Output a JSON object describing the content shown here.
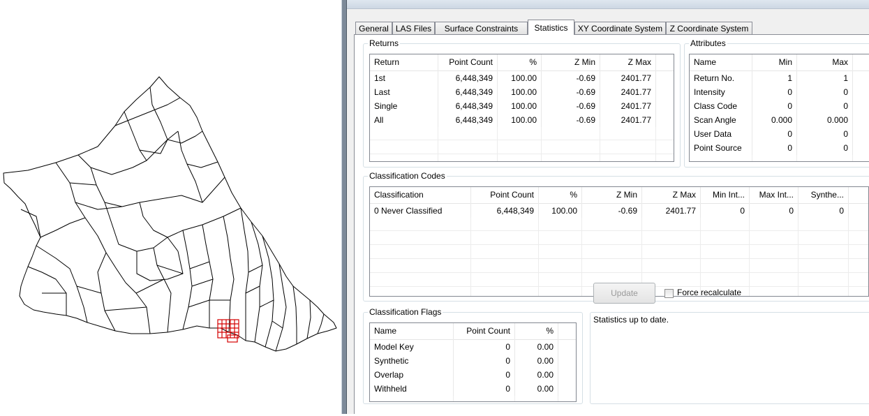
{
  "map": {
    "label": "island-map-with-boundaries",
    "highlight_color": "#d40000"
  },
  "tabs": [
    {
      "label": "General"
    },
    {
      "label": "LAS Files"
    },
    {
      "label": "Surface Constraints"
    },
    {
      "label": "Statistics"
    },
    {
      "label": "XY Coordinate System"
    },
    {
      "label": "Z Coordinate System"
    }
  ],
  "active_tab": "Statistics",
  "returns": {
    "legend": "Returns",
    "headers": [
      "Return",
      "Point Count",
      "%",
      "Z Min",
      "Z Max"
    ],
    "rows": [
      [
        "1st",
        "6,448,349",
        "100.00",
        "-0.69",
        "2401.77"
      ],
      [
        "Last",
        "6,448,349",
        "100.00",
        "-0.69",
        "2401.77"
      ],
      [
        "Single",
        "6,448,349",
        "100.00",
        "-0.69",
        "2401.77"
      ],
      [
        "All",
        "6,448,349",
        "100.00",
        "-0.69",
        "2401.77"
      ]
    ]
  },
  "attributes": {
    "legend": "Attributes",
    "headers": [
      "Name",
      "Min",
      "Max"
    ],
    "rows": [
      [
        "Return No.",
        "1",
        "1"
      ],
      [
        "Intensity",
        "0",
        "0"
      ],
      [
        "Class Code",
        "0",
        "0"
      ],
      [
        "Scan Angle",
        "0.000",
        "0.000"
      ],
      [
        "User Data",
        "0",
        "0"
      ],
      [
        "Point Source",
        "0",
        "0"
      ]
    ]
  },
  "classification_codes": {
    "legend": "Classification Codes",
    "headers": [
      "Classification",
      "Point Count",
      "%",
      "Z Min",
      "Z Max",
      "Min Int...",
      "Max Int...",
      "Synthe..."
    ],
    "rows": [
      [
        "0  Never Classified",
        "6,448,349",
        "100.00",
        "-0.69",
        "2401.77",
        "0",
        "0",
        "0"
      ]
    ]
  },
  "classification_flags": {
    "legend": "Classification Flags",
    "headers": [
      "Name",
      "Point Count",
      "%"
    ],
    "rows": [
      [
        "Model Key",
        "0",
        "0.00"
      ],
      [
        "Synthetic",
        "0",
        "0.00"
      ],
      [
        "Overlap",
        "0",
        "0.00"
      ],
      [
        "Withheld",
        "0",
        "0.00"
      ]
    ]
  },
  "update_button": "Update",
  "force_recalculate": {
    "label": "Force recalculate",
    "checked": false
  },
  "status": "Statistics up to date."
}
